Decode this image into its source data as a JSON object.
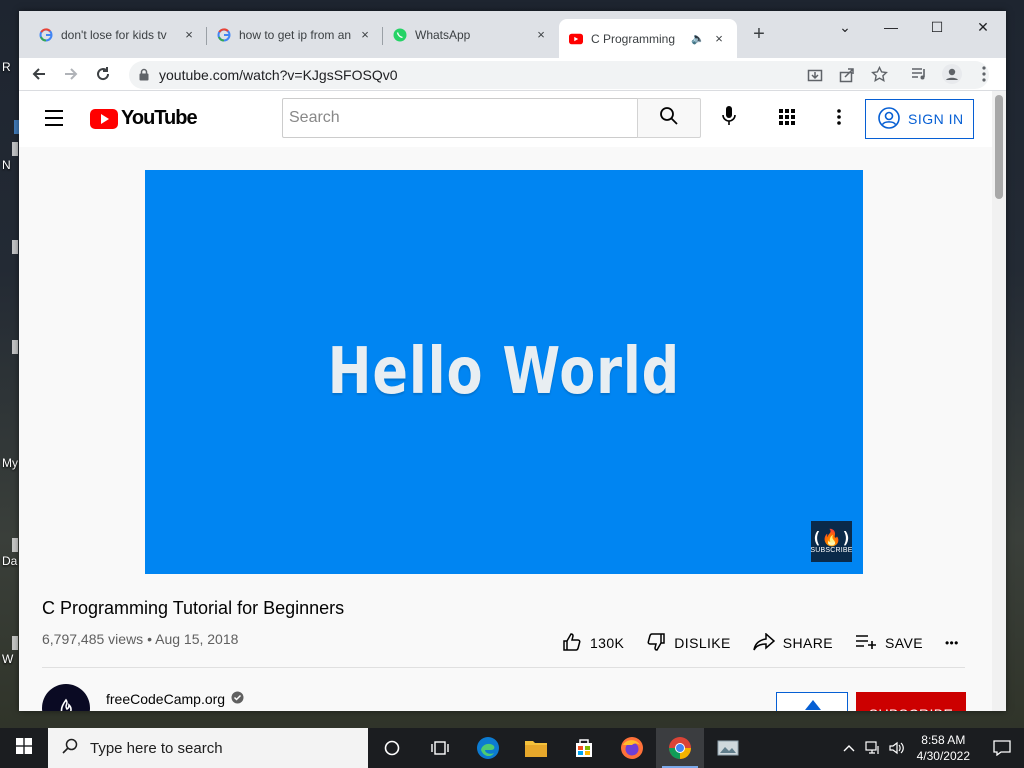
{
  "desktop": {
    "labels": [
      "R",
      "N",
      "My",
      "Da",
      "W"
    ]
  },
  "browser": {
    "tabs": [
      {
        "title": "don't lose for kids tv",
        "favicon": "google-icon",
        "close": "×"
      },
      {
        "title": "how to get ip from an",
        "favicon": "google-icon",
        "close": "×"
      },
      {
        "title": "WhatsApp",
        "favicon": "whatsapp-icon",
        "close": "×"
      },
      {
        "title": "C Programming",
        "favicon": "youtube-icon",
        "close": "×",
        "audio": "speaker-icon"
      }
    ],
    "new_tab": "+",
    "window_controls": {
      "menu": "⌄",
      "minimize": "—",
      "maximize": "☐",
      "close": "✕"
    },
    "url": "youtube.com/watch?v=KJgsSFOSQv0"
  },
  "youtube": {
    "logo_text": "YouTube",
    "search": {
      "placeholder": "Search",
      "value": ""
    },
    "sign_in_label": "SIGN IN",
    "video": {
      "frame_text": "Hello World",
      "watermark_glyph": "(🔥)",
      "watermark_caption": "SUBSCRIBE",
      "title": "C Programming Tutorial for Beginners",
      "views": "6,797,485 views",
      "date": "Aug 15, 2018",
      "meta_sep": "•"
    },
    "actions": {
      "like_count": "130K",
      "dislike_label": "DISLIKE",
      "share_label": "SHARE",
      "save_label": "SAVE",
      "more": "•••"
    },
    "channel": {
      "name": "freeCodeCamp.org",
      "verified": true
    },
    "subscribe_label": "SUBSCRIBE"
  },
  "taskbar": {
    "search_placeholder": "Type here to search",
    "pinned": [
      "cortana-icon",
      "task-view-icon",
      "edge-icon",
      "file-explorer-icon",
      "store-icon",
      "firefox-icon",
      "chrome-icon",
      "photos-icon"
    ],
    "clock_time": "8:58 AM",
    "clock_date": "4/30/2022"
  },
  "colors": {
    "youtube_red": "#ff0000",
    "link_blue": "#065fd4",
    "player_blue": "#0085f2",
    "subscribe_red": "#cc0000",
    "taskbar": "#1b1d20"
  }
}
